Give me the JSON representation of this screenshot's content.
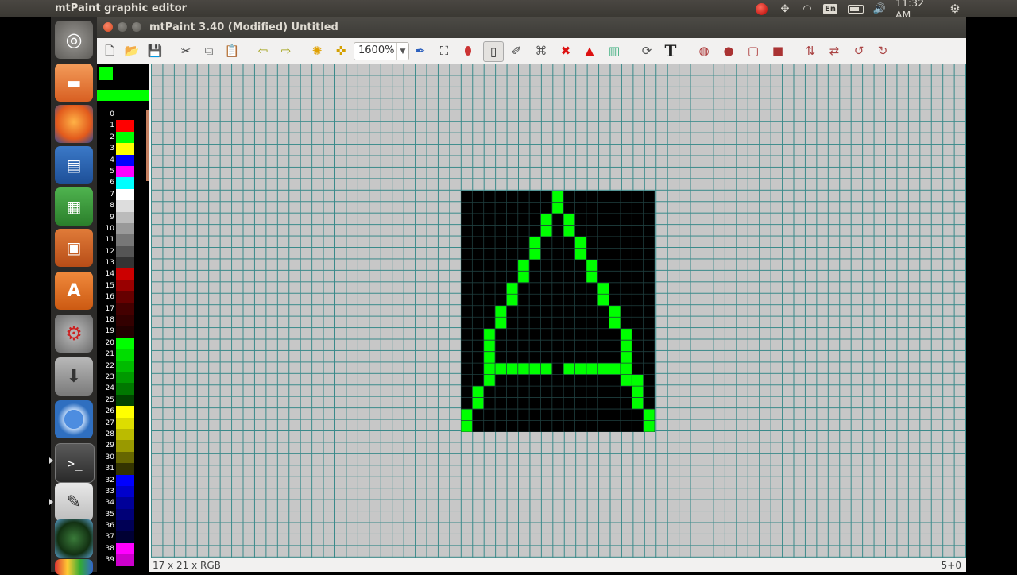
{
  "panel": {
    "app_title": "mtPaint graphic editor",
    "lang_label": "En",
    "clock": "11:32 AM",
    "tray_icons": [
      "record-icon",
      "dropbox-icon",
      "wifi-icon",
      "keyboard-language-icon",
      "battery-icon",
      "volume-icon",
      "gear-icon"
    ]
  },
  "launcher": {
    "items": [
      "ubuntu-dash",
      "files",
      "firefox",
      "libreoffice-writer",
      "libreoffice-calc",
      "libreoffice-impress",
      "software-center",
      "system-settings",
      "update-manager",
      "chromium",
      "terminal",
      "mtpaint",
      "gimp",
      "color-pencils"
    ]
  },
  "window": {
    "title": "mtPaint 3.40 (Modified) Untitled"
  },
  "toolbar": {
    "zoom_value": "1600%",
    "buttons": [
      "new",
      "open",
      "save",
      "cut",
      "copy",
      "paste",
      "undo",
      "redo",
      "pan",
      "zoom-move",
      "paint",
      "select-rect",
      "flood-fill",
      "line",
      "smudge",
      "clone",
      "selection",
      "polygon",
      "gradient",
      "text",
      "ellipse",
      "filled-ellipse",
      "outline-rect",
      "filled-rect",
      "flip-v",
      "flip-h",
      "rotate-left",
      "rotate-right"
    ]
  },
  "palette": {
    "foreground": "#00ff00",
    "background": "#000000",
    "entries": [
      {
        "index": "0",
        "color": "#000000"
      },
      {
        "index": "1",
        "color": "#ff0000"
      },
      {
        "index": "2",
        "color": "#00ff00"
      },
      {
        "index": "3",
        "color": "#ffff00"
      },
      {
        "index": "4",
        "color": "#0000ff"
      },
      {
        "index": "5",
        "color": "#ff00ff"
      },
      {
        "index": "6",
        "color": "#00ffff"
      },
      {
        "index": "7",
        "color": "#ffffff"
      },
      {
        "index": "8",
        "color": "#dddddd"
      },
      {
        "index": "9",
        "color": "#bbbbbb"
      },
      {
        "index": "10",
        "color": "#999999"
      },
      {
        "index": "11",
        "color": "#777777"
      },
      {
        "index": "12",
        "color": "#555555"
      },
      {
        "index": "13",
        "color": "#333333"
      },
      {
        "index": "14",
        "color": "#cc0000"
      },
      {
        "index": "15",
        "color": "#990000"
      },
      {
        "index": "16",
        "color": "#660000"
      },
      {
        "index": "17",
        "color": "#440000"
      },
      {
        "index": "18",
        "color": "#330000"
      },
      {
        "index": "19",
        "color": "#220000"
      },
      {
        "index": "20",
        "color": "#00ff00"
      },
      {
        "index": "21",
        "color": "#00dd00"
      },
      {
        "index": "22",
        "color": "#00bb00"
      },
      {
        "index": "23",
        "color": "#009900"
      },
      {
        "index": "24",
        "color": "#007700"
      },
      {
        "index": "25",
        "color": "#004400"
      },
      {
        "index": "26",
        "color": "#ffff00"
      },
      {
        "index": "27",
        "color": "#dddd00"
      },
      {
        "index": "28",
        "color": "#bbbb00"
      },
      {
        "index": "29",
        "color": "#999900"
      },
      {
        "index": "30",
        "color": "#666600"
      },
      {
        "index": "31",
        "color": "#333300"
      },
      {
        "index": "32",
        "color": "#0000ff"
      },
      {
        "index": "33",
        "color": "#0000cc"
      },
      {
        "index": "34",
        "color": "#000099"
      },
      {
        "index": "35",
        "color": "#000077"
      },
      {
        "index": "36",
        "color": "#000055"
      },
      {
        "index": "37",
        "color": "#000033"
      },
      {
        "index": "38",
        "color": "#ff00ff"
      },
      {
        "index": "39",
        "color": "#cc00cc"
      }
    ]
  },
  "canvas": {
    "image_columns": 17,
    "image_rows": 21,
    "image_background": "#000000",
    "image_ink": "#00ff00",
    "drawn_pixels": [
      [
        8,
        0
      ],
      [
        8,
        1
      ],
      [
        7,
        2
      ],
      [
        9,
        2
      ],
      [
        7,
        3
      ],
      [
        9,
        3
      ],
      [
        6,
        4
      ],
      [
        10,
        4
      ],
      [
        6,
        5
      ],
      [
        10,
        5
      ],
      [
        5,
        6
      ],
      [
        11,
        6
      ],
      [
        5,
        7
      ],
      [
        11,
        7
      ],
      [
        4,
        8
      ],
      [
        12,
        8
      ],
      [
        4,
        9
      ],
      [
        12,
        9
      ],
      [
        3,
        10
      ],
      [
        13,
        10
      ],
      [
        3,
        11
      ],
      [
        13,
        11
      ],
      [
        2,
        12
      ],
      [
        14,
        12
      ],
      [
        2,
        13
      ],
      [
        14,
        13
      ],
      [
        3,
        15
      ],
      [
        4,
        15
      ],
      [
        5,
        15
      ],
      [
        6,
        15
      ],
      [
        7,
        15
      ],
      [
        9,
        15
      ],
      [
        10,
        15
      ],
      [
        11,
        15
      ],
      [
        12,
        15
      ],
      [
        13,
        15
      ],
      [
        14,
        15
      ],
      [
        2,
        14
      ],
      [
        2,
        15
      ],
      [
        2,
        16
      ],
      [
        14,
        14
      ],
      [
        14,
        16
      ],
      [
        15,
        16
      ],
      [
        1,
        17
      ],
      [
        15,
        17
      ],
      [
        1,
        18
      ],
      [
        15,
        18
      ],
      [
        0,
        19
      ],
      [
        16,
        19
      ],
      [
        0,
        20
      ],
      [
        16,
        20
      ]
    ]
  },
  "status": {
    "dimensions": "17 x 21 x RGB",
    "coords": "5+0"
  }
}
